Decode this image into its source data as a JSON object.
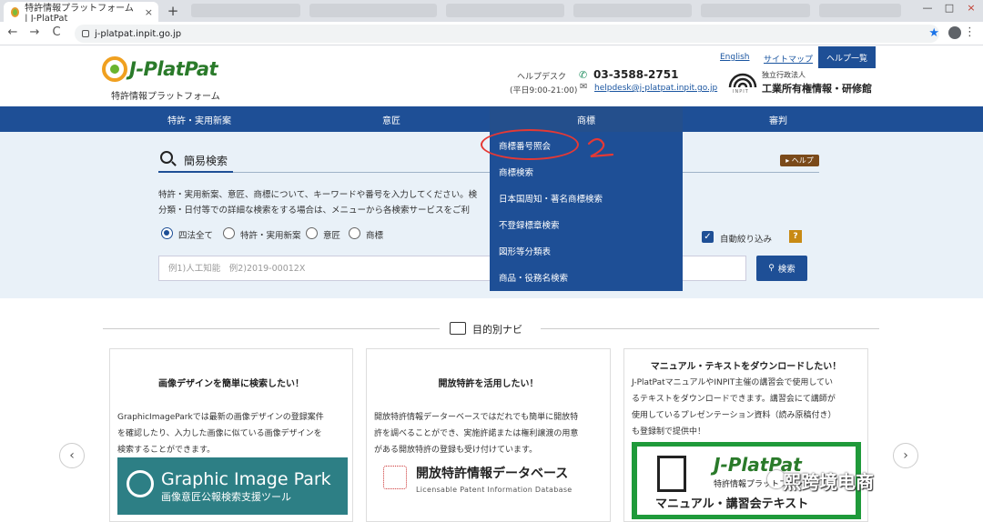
{
  "browser": {
    "tab_title": "特許情報プラットフォーム | J-PlatPat",
    "tab_close": "×",
    "new_tab": "+",
    "url": "j-platpat.inpit.go.jp",
    "back": "←",
    "forward": "→",
    "reload": "C",
    "star": "★",
    "menu": "⋮",
    "minimize": "—",
    "maximize": "□",
    "close": "×"
  },
  "header": {
    "logo_text": "J-PlatPat",
    "logo_sub": "特許情報プラットフォーム",
    "helpdesk_label": "ヘルプデスク",
    "helpdesk_hours": "(平日9:00-21:00)",
    "phone": "03-3588-2751",
    "email": "helpdesk@j-platpat.inpit.go.jp",
    "link_english": "English",
    "link_sitemap": "サイトマップ",
    "help_list": "ヘルプ一覧",
    "inpit_small": "独立行政法人",
    "inpit_name": "工業所有権情報・研修館",
    "inpit_sub": "INPIT"
  },
  "nav": {
    "patent": "特許・実用新案",
    "design": "意匠",
    "trademark": "商標",
    "trial": "審判"
  },
  "dropdown": {
    "items": [
      "商標番号照会",
      "商標検索",
      "日本国周知・著名商標検索",
      "不登録標章検索",
      "図形等分類表",
      "商品・役務名検索"
    ],
    "annotation": "2"
  },
  "search": {
    "title": "簡易検索",
    "help": "▸ ヘルプ",
    "desc1": "特許・実用新案、意匠、商標について、キーワードや番号を入力してください。検",
    "desc2": "分類・日付等での詳細な検索をする場合は、メニューから各検索サービスをご利",
    "radios": [
      "四法全て",
      "特許・実用新案",
      "意匠",
      "商標"
    ],
    "auto_label": "自動絞り込み",
    "auto_check": "✓",
    "q": "?",
    "placeholder": "例1)人工知能　例2)2019-00012X",
    "button": "検索",
    "button_icon": "🔍"
  },
  "navi": {
    "title": "目的別ナビ",
    "card1": {
      "title": "画像デザインを簡単に検索したい！",
      "text": [
        "GraphicImageParkでは最新の画像デザインの登録案件",
        "を確認したり、入力した画像に似ている画像デザインを",
        "検索することができます。"
      ],
      "banner_big": "Graphic Image Park",
      "banner_small": "画像意匠公報検索支援ツール"
    },
    "card2": {
      "title": "開放特許を活用したい！",
      "text": [
        "開放特許情報データーベースではだれでも簡単に開放特",
        "許を調べることができ、実施許諾または権利譲渡の用意",
        "がある開放特許の登録も受け付けています。"
      ],
      "banner_title": "開放特許情報データベース",
      "banner_sub": "Licensable Patent Information Database"
    },
    "card3": {
      "title": "マニュアル・テキストをダウンロードしたい！",
      "text": [
        "J-PlatPatマニュアルやINPIT主催の講習会で使用してい",
        "るテキストをダウンロードできます。講習会にて講師が",
        "使用しているプレゼンテーション資料（読み原稿付き）",
        "も登録制で提供中！"
      ],
      "banner_logo": "J-PlatPat",
      "banner_sub": "特許情報プラットフォーム",
      "banner_big": "マニュアル・講習会テキスト"
    },
    "prev": "‹",
    "next": "›"
  },
  "watermark": "熙跨境电商"
}
